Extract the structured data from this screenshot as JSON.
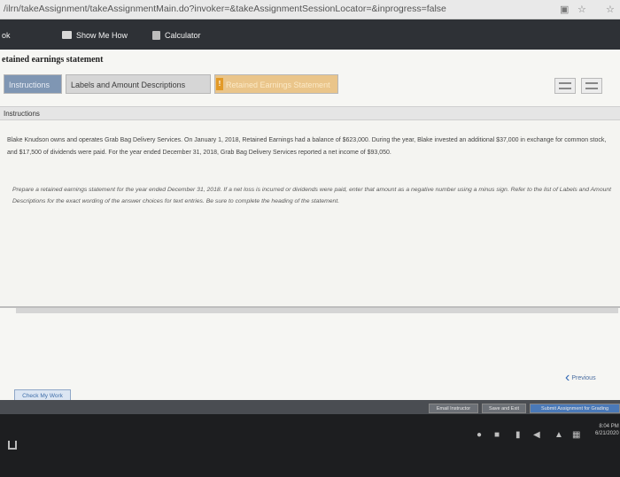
{
  "browser": {
    "url": "/ilrn/takeAssignment/takeAssignmentMain.do?invoker=&takeAssignmentSessionLocator=&inprogress=false"
  },
  "app_bar": {
    "left_text": "ok",
    "show_me_how": "Show Me How",
    "calculator": "Calculator"
  },
  "page": {
    "title": "etained earnings statement",
    "tabs": [
      {
        "label": "Instructions"
      },
      {
        "label": "Labels and Amount Descriptions"
      },
      {
        "label": "Retained Earnings Statement"
      }
    ],
    "instructions_header": "Instructions",
    "paragraph1": "Blake Knudson owns and operates Grab Bag Delivery Services. On January 1, 2018, Retained Earnings had a balance of $623,000. During the year, Blake invested an additional $37,000 in exchange for common stock, and $17,500 of dividends were paid. For the year ended December 31, 2018, Grab Bag Delivery Services reported a net income of $93,050.",
    "paragraph2": "Prepare a retained earnings statement for the year ended December 31, 2018. If a net loss is incurred or dividends were paid, enter that amount as a negative number using a minus sign. Refer to the list of Labels and Amount Descriptions for the exact wording of the answer choices for text entries. Be sure to complete the heading of the statement.",
    "previous": "Previous",
    "check_my_work": "Check My Work"
  },
  "footer": {
    "email_instructor": "Email Instructor",
    "save_and_exit": "Save and Exit",
    "submit": "Submit Assignment for Grading"
  },
  "system": {
    "time": "8:04 PM",
    "date": "6/21/2020"
  }
}
